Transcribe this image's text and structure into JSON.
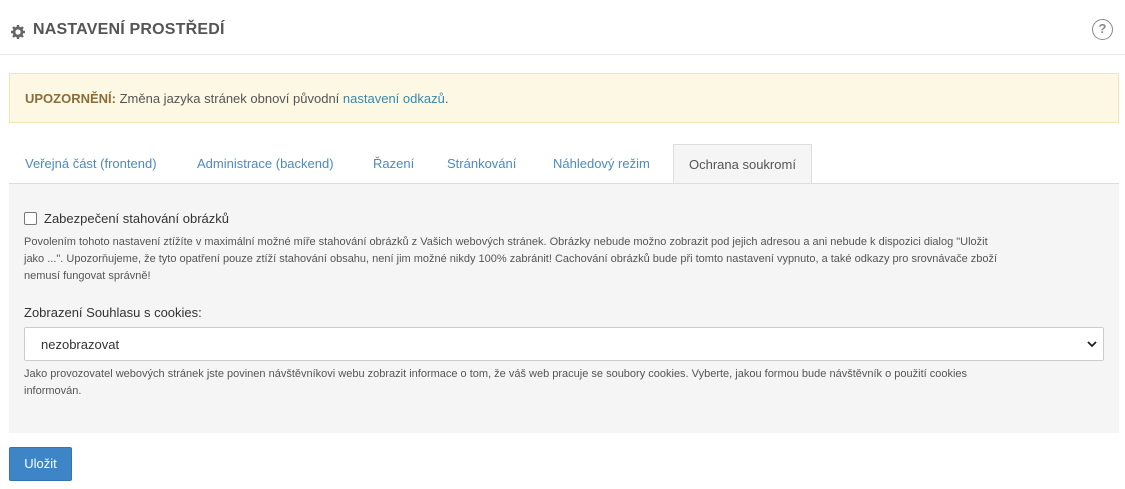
{
  "header": {
    "title": "NASTAVENÍ PROSTŘEDÍ",
    "icon": "gear-icon",
    "help_glyph": "?"
  },
  "alert": {
    "strong": "UPOZORNĚNÍ:",
    "text": " Změna jazyka stránek obnoví původní ",
    "link": "nastavení odkazů",
    "end": "."
  },
  "tabs": [
    {
      "label": "Veřejná část (frontend)"
    },
    {
      "label": "Administrace (backend)"
    },
    {
      "label": "Řazení"
    },
    {
      "label": "Stránkování"
    },
    {
      "label": "Náhledový režim"
    },
    {
      "label": "Ochrana soukromí",
      "active": true
    }
  ],
  "image_protection": {
    "checkbox_label": "Zabezpečení stahování obrázků",
    "checked": false,
    "help_lines": [
      "Povolením tohoto nastavení ztížíte v maximální možné míře stahování obrázků z Vašich webových stránek. Obrázky nebude možno zobrazit pod jejich adresou a ani nebude k dispozici dialog \"Uložit",
      "jako ...\". Upozorňujeme, že tyto opatření pouze ztíží stahování obsahu, není jim možné nikdy 100% zabránit! Cachování obrázků bude při tomto nastavení vypnuto, a také odkazy pro srovnávače zboží",
      "nemusí fungovat správně!"
    ]
  },
  "cookies": {
    "label": "Zobrazení Souhlasu s cookies:",
    "selected": "nezobrazovat",
    "help_lines": [
      "Jako provozovatel webových stránek jste povinen návštěvníkovi webu zobrazit informace o tom, že váš web pracuje se soubory cookies. Vyberte, jakou formou bude návštěvník o použití cookies",
      "informován."
    ]
  },
  "save_label": "Uložit",
  "colors": {
    "link": "#4a8bc2",
    "primary_button": "#3d85c6",
    "alert_bg": "#fcf8e3",
    "alert_strong": "#8a6d3b",
    "panel_bg": "#f5f5f5"
  }
}
